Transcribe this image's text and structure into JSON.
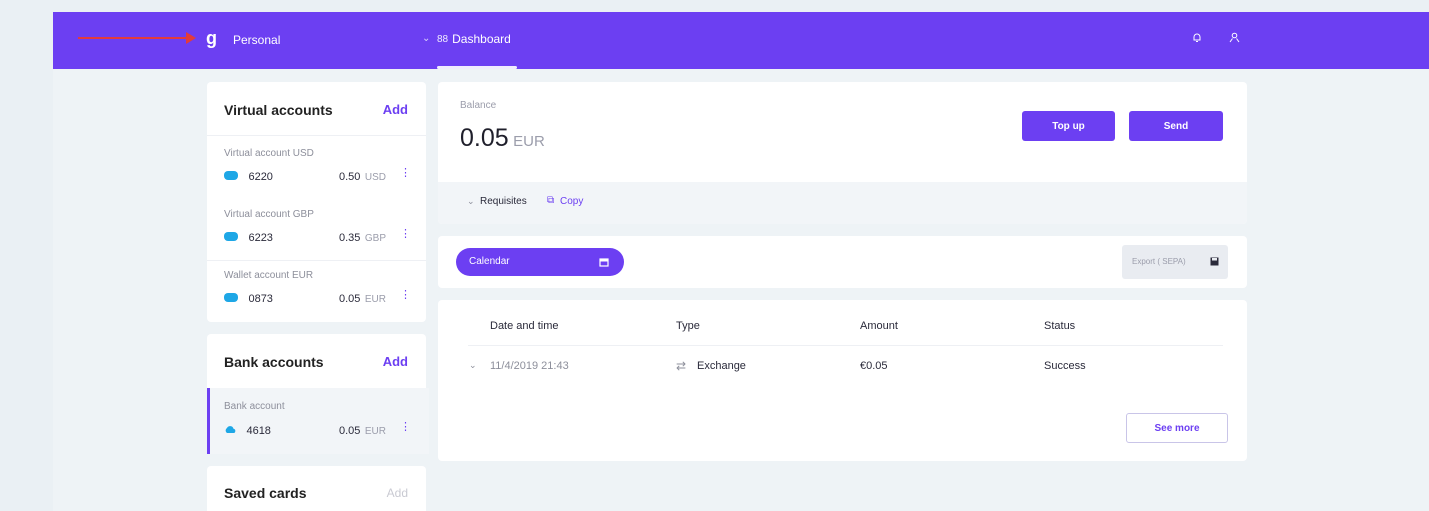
{
  "nav": {
    "logo": "g",
    "profile": "Personal",
    "profile_chevron": "⌄",
    "dashboard_icon": "88",
    "dashboard": "Dashboard",
    "bell_icon": "bell-icon",
    "user_icon": "user-icon",
    "accent": "#6c3ff2"
  },
  "virtual": {
    "title": "Virtual accounts",
    "add": "Add",
    "items": [
      {
        "name": "Virtual account USD",
        "number": "6220",
        "amount": "0.50",
        "currency": "USD"
      },
      {
        "name": "Virtual account GBP",
        "number": "6223",
        "amount": "0.35",
        "currency": "GBP"
      },
      {
        "name": "Wallet account EUR",
        "number": "0873",
        "amount": "0.05",
        "currency": "EUR"
      }
    ]
  },
  "bank": {
    "title": "Bank accounts",
    "add": "Add",
    "items": [
      {
        "name": "Bank account",
        "number": "4618",
        "amount": "0.05",
        "currency": "EUR"
      }
    ]
  },
  "cards": {
    "title": "Saved cards",
    "add": "Add"
  },
  "balance": {
    "label": "Balance",
    "amount": "0.05",
    "currency": "EUR",
    "topup": "Top up",
    "send": "Send",
    "requisites": "Requisites",
    "copy": "Copy"
  },
  "filters": {
    "calendar": "Calendar",
    "export": "Export ( SEPA)"
  },
  "table": {
    "headers": [
      "Date and time",
      "Type",
      "Amount",
      "Status"
    ],
    "rows": [
      {
        "date": "11/4/2019 21:43",
        "type": "Exchange",
        "amount": "€0.05",
        "status": "Success"
      }
    ],
    "see_more": "See more"
  }
}
